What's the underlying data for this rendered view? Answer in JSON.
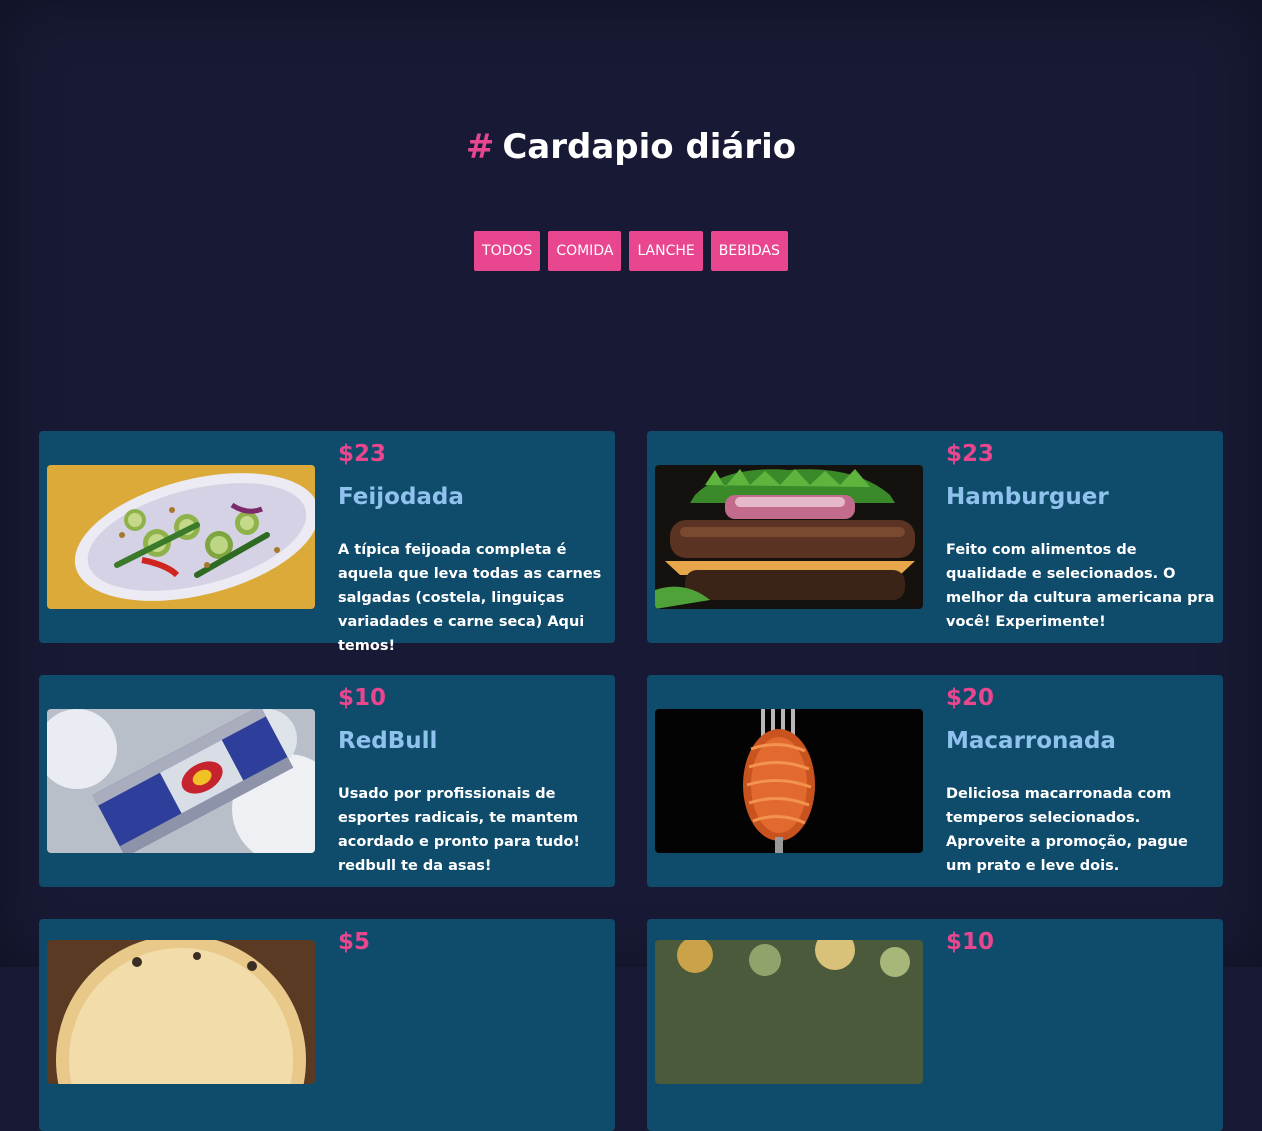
{
  "header": {
    "hash": "#",
    "title": "Cardapio diário"
  },
  "filters": [
    "TODOS",
    "COMIDA",
    "LANCHE",
    "BEBIDAS"
  ],
  "colors": {
    "background": "#181a35",
    "accent": "#e8468f",
    "card": "#0f4b6b",
    "item_name": "#8fc3ee"
  },
  "menu": [
    {
      "price": "$23",
      "name": "Feijodada",
      "description": "A típica feijoada completa é aquela que leva todas as carnes salgadas (costela, linguiças variadades e carne seca) Aqui temos!",
      "image": "salad-photo"
    },
    {
      "price": "$23",
      "name": "Hamburguer",
      "description": "Feito com alimentos de qualidade e selecionados. O melhor da cultura americana pra você! Experimente!",
      "image": "burger-photo"
    },
    {
      "price": "$10",
      "name": "RedBull",
      "description": "Usado por profissionais de esportes radicais, te mantem acordado e pronto para tudo! redbull te da asas!",
      "image": "energy-drink-photo"
    },
    {
      "price": "$20",
      "name": "Macarronada",
      "description": "Deliciosa macarronada com temperos selecionados. Aproveite a promoção, pague um prato e leve dois.",
      "image": "spaghetti-fork-photo"
    },
    {
      "price": "$5",
      "image": "pizza-photo"
    },
    {
      "price": "$10",
      "image": "food-photo"
    }
  ]
}
